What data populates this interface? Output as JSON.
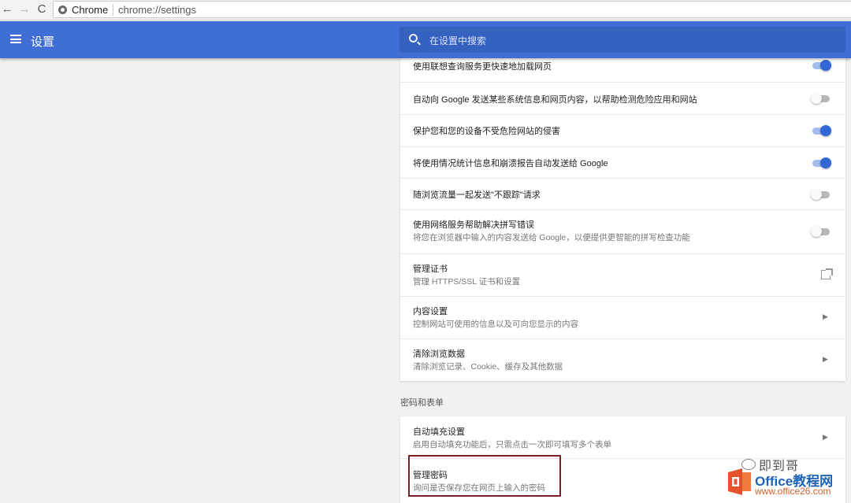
{
  "browser": {
    "site_name": "Chrome",
    "url": "chrome://settings",
    "back_icon": "←",
    "forward_icon": "→",
    "reload_icon": "C"
  },
  "header": {
    "title": "设置",
    "search_placeholder": "在设置中搜索"
  },
  "privacy_rows": [
    {
      "label": "使用联想查询服务更快速地加载网页",
      "control": "toggle",
      "on": true
    },
    {
      "label": "自动向 Google 发送某些系统信息和网页内容，以帮助检测危险应用和网站",
      "control": "toggle",
      "on": false
    },
    {
      "label": "保护您和您的设备不受危险网站的侵害",
      "control": "toggle",
      "on": true
    },
    {
      "label": "将使用情况统计信息和崩溃报告自动发送给 Google",
      "control": "toggle",
      "on": true
    },
    {
      "label": "随浏览流量一起发送\"不跟踪\"请求",
      "control": "toggle",
      "on": false
    },
    {
      "label": "使用网络服务帮助解决拼写错误",
      "sub": "将您在浏览器中输入的内容发送给 Google，以便提供更智能的拼写检查功能",
      "control": "toggle",
      "on": false
    },
    {
      "label": "管理证书",
      "sub": "管理 HTTPS/SSL 证书和设置",
      "control": "external"
    },
    {
      "label": "内容设置",
      "sub": "控制网站可使用的信息以及可向您显示的内容",
      "control": "chevron"
    },
    {
      "label": "清除浏览数据",
      "sub": "清除浏览记录、Cookie、缓存及其他数据",
      "control": "chevron"
    }
  ],
  "passwords_section": {
    "heading": "密码和表单",
    "rows": [
      {
        "label": "自动填充设置",
        "sub": "启用自动填充功能后，只需点击一次即可填写多个表单",
        "control": "chevron"
      },
      {
        "label": "管理密码",
        "sub": "询问是否保存您在网页上输入的密码",
        "control": "none",
        "highlighted": true
      }
    ]
  },
  "chevron_glyph": "▶",
  "watermark": {
    "brand": "即到哥",
    "site_line1": "Office教程网",
    "site_line2": "www.office26.com"
  },
  "colors": {
    "header_bg": "#3f6fd5",
    "toggle_on": "#3367d6",
    "highlight_border": "#7b1f22"
  }
}
